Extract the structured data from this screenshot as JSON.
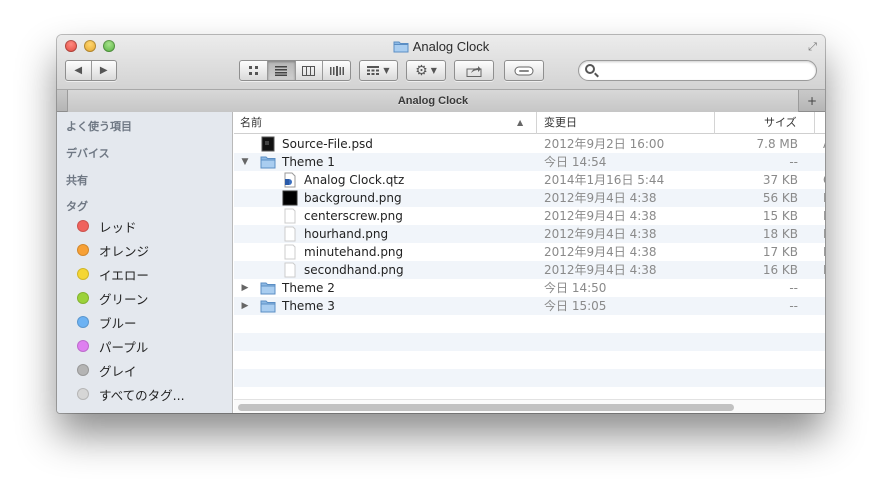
{
  "window": {
    "title": "Analog Clock"
  },
  "toolbar": {
    "back_label": "◀",
    "forward_label": "▶",
    "search_placeholder": ""
  },
  "tabbar": {
    "tab_label": "Analog Clock",
    "add_label": "+"
  },
  "sidebar": {
    "favorites_header": "よく使う項目",
    "devices_header": "デバイス",
    "shared_header": "共有",
    "tags_header": "タグ",
    "tags": [
      {
        "label": "レッド",
        "color": "#f0625d"
      },
      {
        "label": "オレンジ",
        "color": "#f7a035"
      },
      {
        "label": "イエロー",
        "color": "#f5d633"
      },
      {
        "label": "グリーン",
        "color": "#9bd23a"
      },
      {
        "label": "ブルー",
        "color": "#6cb2f3"
      },
      {
        "label": "パープル",
        "color": "#de7ff0"
      },
      {
        "label": "グレイ",
        "color": "#b4b4b4"
      },
      {
        "label": "すべてのタグ...",
        "color": "#d6d6d6"
      }
    ]
  },
  "columns": {
    "name": "名前",
    "date": "変更日",
    "size": "サイズ"
  },
  "files": [
    {
      "name": "Source-File.psd",
      "date": "2012年9月2日 16:00",
      "size": "7.8 MB",
      "kind": "A",
      "icon": "psd-file-icon",
      "level": 0,
      "disclosure": ""
    },
    {
      "name": "Theme 1",
      "date": "今日 14:54",
      "size": "--",
      "kind": "",
      "icon": "folder-icon",
      "level": 0,
      "disclosure": "▼"
    },
    {
      "name": "Analog Clock.qtz",
      "date": "2014年1月16日 5:44",
      "size": "37 KB",
      "kind": "C",
      "icon": "qtz-file-icon",
      "level": 1,
      "disclosure": ""
    },
    {
      "name": "background.png",
      "date": "2012年9月4日 4:38",
      "size": "56 KB",
      "kind": "P",
      "icon": "black-image-icon",
      "level": 1,
      "disclosure": ""
    },
    {
      "name": "centerscrew.png",
      "date": "2012年9月4日 4:38",
      "size": "15 KB",
      "kind": "P",
      "icon": "blank-image-icon",
      "level": 1,
      "disclosure": ""
    },
    {
      "name": "hourhand.png",
      "date": "2012年9月4日 4:38",
      "size": "18 KB",
      "kind": "P",
      "icon": "blank-image-icon",
      "level": 1,
      "disclosure": ""
    },
    {
      "name": "minutehand.png",
      "date": "2012年9月4日 4:38",
      "size": "17 KB",
      "kind": "P",
      "icon": "blank-image-icon",
      "level": 1,
      "disclosure": ""
    },
    {
      "name": "secondhand.png",
      "date": "2012年9月4日 4:38",
      "size": "16 KB",
      "kind": "P",
      "icon": "blank-image-icon",
      "level": 1,
      "disclosure": ""
    },
    {
      "name": "Theme 2",
      "date": "今日 14:50",
      "size": "--",
      "kind": "",
      "icon": "folder-icon",
      "level": 0,
      "disclosure": "▶"
    },
    {
      "name": "Theme 3",
      "date": "今日 15:05",
      "size": "--",
      "kind": "",
      "icon": "folder-icon",
      "level": 0,
      "disclosure": "▶"
    }
  ]
}
